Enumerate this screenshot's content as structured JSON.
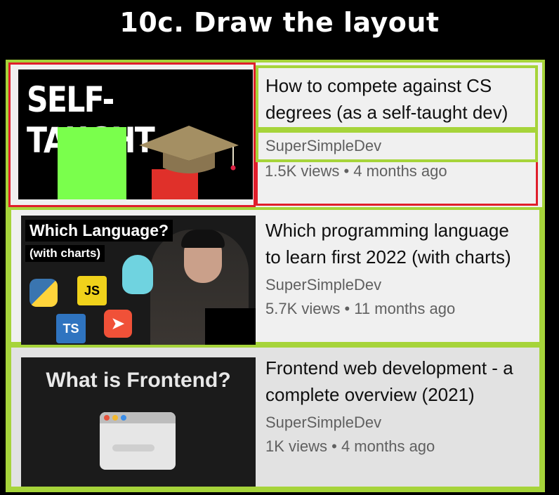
{
  "slide": {
    "title": "10c. Draw the layout"
  },
  "videos": [
    {
      "thumb_text": "SELF-TAUGHT",
      "title_line1": "How to compete against CS",
      "title_line2": "degrees (as a self-taught dev)",
      "channel": "SuperSimpleDev",
      "meta": "1.5K views • 4 months ago"
    },
    {
      "thumb_text": "Which Language?",
      "thumb_subtext": "(with charts)",
      "badge_js": "JS",
      "badge_ts": "TS",
      "title_line1": "Which programming language",
      "title_line2": "to learn first 2022 (with charts)",
      "channel": "SuperSimpleDev",
      "meta": "5.7K views • 11 months ago"
    },
    {
      "thumb_text": "What is Frontend?",
      "title_line1": "Frontend web development - a",
      "title_line2": "complete overview (2021)",
      "channel": "SuperSimpleDev",
      "meta": "1K views • 4 months ago"
    }
  ],
  "colors": {
    "annotation_green": "#a6d43a",
    "annotation_red": "#e01e2b"
  },
  "icons": [
    "python-icon",
    "javascript-icon",
    "typescript-icon",
    "swift-icon",
    "go-gopher-icon",
    "graduation-cap-icon",
    "browser-window-icon"
  ]
}
